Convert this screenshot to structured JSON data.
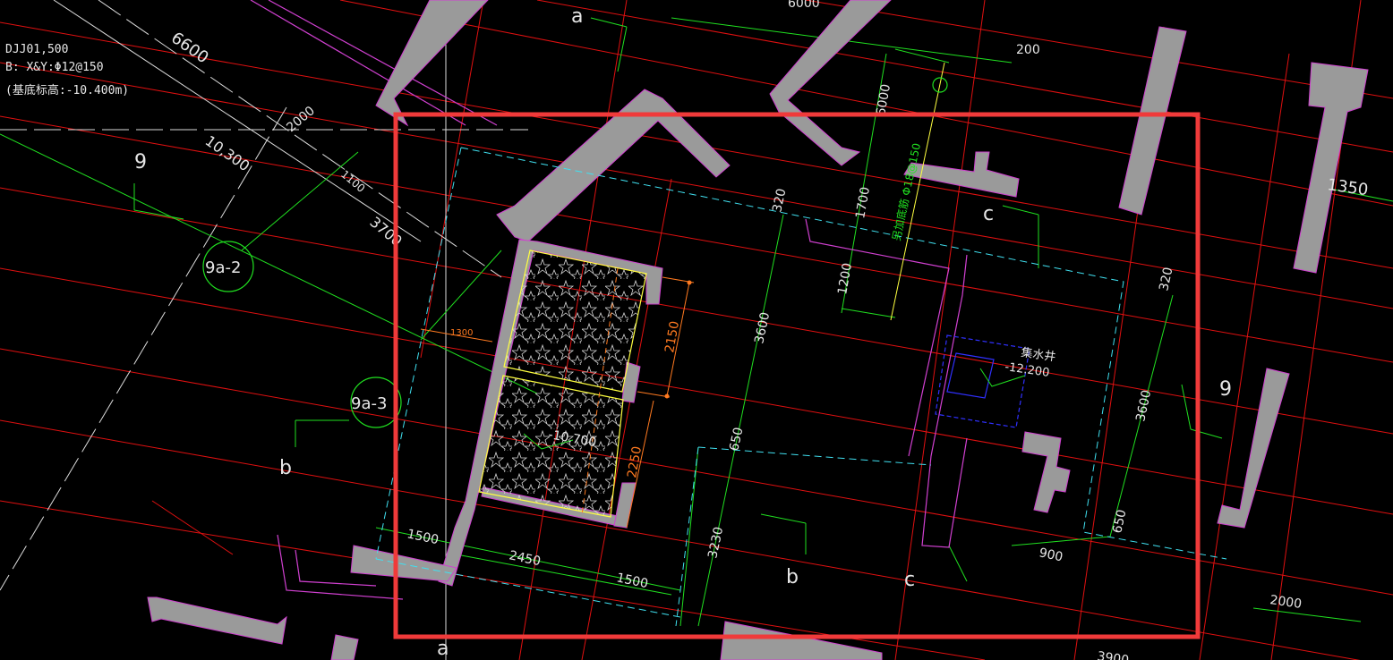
{
  "notes": {
    "line1": "DJJ01,500",
    "line2": "B: X&Y:Φ12@150",
    "line3": "(基底标高:-10.400m)"
  },
  "colors": {
    "background": "#000000",
    "wall_fill": "#9a9a9a",
    "wall_edge": "#d040d0",
    "grid_line": "#e01010",
    "dim_green": "#20e020",
    "dim_orange": "#ff7a20",
    "cyan_dash": "#40e0f0",
    "blue_pit": "#3030ff",
    "yellow": "#ffff40",
    "highlight": "#f03a3a"
  },
  "axis_labels": {
    "a_top": "a",
    "a_bottom": "a",
    "b_left": "b",
    "b_mid": "b",
    "c_upper": "c",
    "c_lower": "c",
    "nine_left": "9",
    "nine_right": "9"
  },
  "bubbles": {
    "b1": "9a-2",
    "b2": "9a-3"
  },
  "dimensions": {
    "d6600": "6600",
    "d6000": "6000",
    "d200": "200",
    "d2000_left": "2000",
    "d10300": "10,300",
    "d1100": "1100",
    "d3700": "3700",
    "d1700": "1700",
    "d1200": "1200",
    "d3600_left": "3600",
    "d320_top": "320",
    "d320_right": "320",
    "d2150": "2150",
    "d2250": "2250",
    "d1300": "1300",
    "d650_left": "650",
    "d3230": "3230",
    "d1500_left": "1500",
    "d2450": "2450",
    "d1500_bottom": "1500",
    "d3600_right": "3600",
    "d650_right": "650",
    "d900": "900",
    "d1350": "1350",
    "d2000_right": "2000",
    "d3900": "3900",
    "d6000_v": "6000"
  },
  "annotations": {
    "pit_elev": "-10.700",
    "sump_label": "集水井",
    "sump_elev": "-12.200",
    "rebar_note": "另加底筋 Φ18@150"
  }
}
